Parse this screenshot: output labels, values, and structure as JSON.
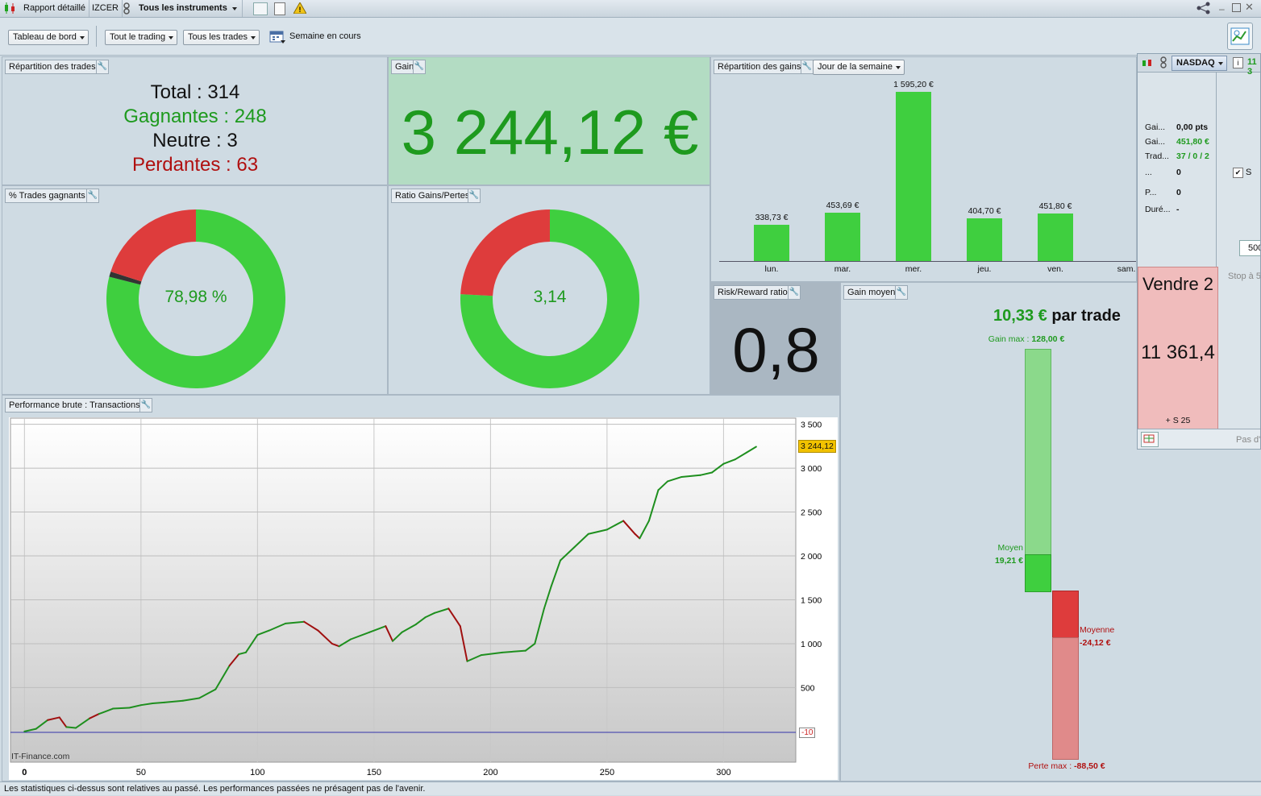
{
  "titlebar": {
    "report": "Rapport détaillé",
    "account": "IZCER",
    "instruments": "Tous les instruments"
  },
  "toolbar": {
    "dashboard": "Tableau de bord",
    "trading": "Tout le trading",
    "trades": "Tous les trades",
    "period": "Semaine en cours"
  },
  "repartition_trades": {
    "title": "Répartition des trades",
    "total_label": "Total",
    "total_value": "314",
    "winners_label": "Gagnantes",
    "winners_value": "248",
    "neutral_label": "Neutre",
    "neutral_value": "3",
    "losers_label": "Perdantes",
    "losers_value": "63"
  },
  "gain": {
    "title": "Gain",
    "value": "3 244,12 €"
  },
  "pct_winning": {
    "title": "% Trades gagnants",
    "center": "78,98 %",
    "fraction_win": 0.7898,
    "fraction_neutral": 0.0096,
    "fraction_loss": 0.2006
  },
  "ratio": {
    "title": "Ratio Gains/Pertes",
    "center": "3,14",
    "fraction_win": 0.7584
  },
  "repartition_gains": {
    "title": "Répartition des gains",
    "mode": "Jour de la semaine"
  },
  "risk_reward": {
    "title": "Risk/Reward ratio",
    "value": "0,8"
  },
  "gain_moyen": {
    "title": "Gain moyen",
    "headline_value": "10,33 €",
    "headline_suffix": "par trade",
    "gain_max_label": "Gain max :",
    "gain_max_value": "128,00 €",
    "moyen_label": "Moyen",
    "moyen_value": "19,21 €",
    "moyenne_label": "Moyenne",
    "moyenne_value": "-24,12 €",
    "perte_max_label": "Perte max :",
    "perte_max_value": "-88,50 €"
  },
  "performance": {
    "title": "Performance brute : Transactions",
    "last_value_tag": "3 244,12",
    "baseline_tag": "-10",
    "watermark": "IT-Finance.com"
  },
  "side_panel": {
    "instrument": "NASDAQ",
    "price_peek": "11 3",
    "rows": [
      {
        "label": "Gai...",
        "value": "0,00 pts"
      },
      {
        "label": "Gai...",
        "value": "451,80 €"
      },
      {
        "label": "Trad...",
        "value": "37 / 0 / 2"
      },
      {
        "label": "...",
        "value": "0"
      },
      {
        "label": "P...",
        "value": "0"
      },
      {
        "label": "Duré...",
        "value": "-"
      }
    ],
    "checkbox_label": "S",
    "qty": "500",
    "stop_label": "Stop à 5",
    "sell_title": "Vendre 2",
    "sell_price": "11 361,4",
    "sell_sub": "+ S 25",
    "pas_label": "Pas d'"
  },
  "status_text": "Les statistiques ci-dessus sont relatives au passé. Les performances passées ne présagent pas de l'avenir.",
  "colors": {
    "green": "#1e9a1e",
    "bar_green": "#3fcf3f",
    "red": "#b01010",
    "donut_red": "#de3c3c"
  },
  "chart_data": [
    {
      "type": "bar",
      "title": "Répartition des gains",
      "categories": [
        "lun.",
        "mar.",
        "mer.",
        "jeu.",
        "ven.",
        "sam."
      ],
      "values": [
        338.73,
        453.69,
        1595.2,
        404.7,
        451.8,
        null
      ],
      "value_labels": [
        "338,73 €",
        "453,69 €",
        "1 595,20 €",
        "404,70 €",
        "451,80 €",
        ""
      ]
    },
    {
      "type": "line",
      "title": "Performance brute : Transactions",
      "x_ticks": [
        "0",
        "50",
        "100",
        "150",
        "200",
        "250",
        "300"
      ],
      "y_ticks": [
        "500",
        "1 000",
        "1 500",
        "2 000",
        "2 500",
        "3 000",
        "3 500"
      ],
      "xlim": [
        -6,
        331
      ],
      "ylim": [
        -350,
        3570
      ],
      "baseline": -10,
      "x": [
        0,
        5,
        10,
        15,
        18,
        22,
        28,
        32,
        38,
        45,
        50,
        55,
        60,
        68,
        75,
        82,
        88,
        92,
        95,
        100,
        105,
        112,
        120,
        126,
        132,
        135,
        140,
        148,
        155,
        158,
        162,
        168,
        172,
        176,
        182,
        187,
        190,
        196,
        205,
        215,
        219,
        223,
        226,
        230,
        236,
        242,
        250,
        257,
        262,
        264,
        268,
        272,
        276,
        282,
        290,
        295,
        300,
        305,
        310,
        314
      ],
      "y": [
        0,
        30,
        130,
        160,
        50,
        40,
        150,
        200,
        260,
        270,
        300,
        320,
        330,
        350,
        380,
        480,
        750,
        880,
        900,
        1100,
        1150,
        1230,
        1250,
        1150,
        1000,
        970,
        1050,
        1130,
        1200,
        1030,
        1130,
        1220,
        1300,
        1350,
        1400,
        1200,
        800,
        870,
        900,
        920,
        1000,
        1400,
        1650,
        1950,
        2100,
        2250,
        2300,
        2400,
        2250,
        2200,
        2400,
        2750,
        2850,
        2900,
        2920,
        2950,
        3050,
        3100,
        3180,
        3244.12
      ],
      "segment_colors": [
        "green",
        "green",
        "red",
        "red",
        "green",
        "green",
        "red",
        "green",
        "green",
        "green",
        "green",
        "green",
        "green",
        "green",
        "green",
        "green",
        "red",
        "green",
        "green",
        "green",
        "green",
        "green",
        "red",
        "red",
        "red",
        "green",
        "green",
        "green",
        "red",
        "green",
        "green",
        "green",
        "green",
        "green",
        "red",
        "red",
        "green",
        "green",
        "green",
        "green",
        "green",
        "green",
        "green",
        "green",
        "green",
        "green",
        "green",
        "red",
        "red",
        "green",
        "green",
        "green",
        "green",
        "green",
        "green",
        "green",
        "green",
        "green",
        "green"
      ]
    }
  ]
}
